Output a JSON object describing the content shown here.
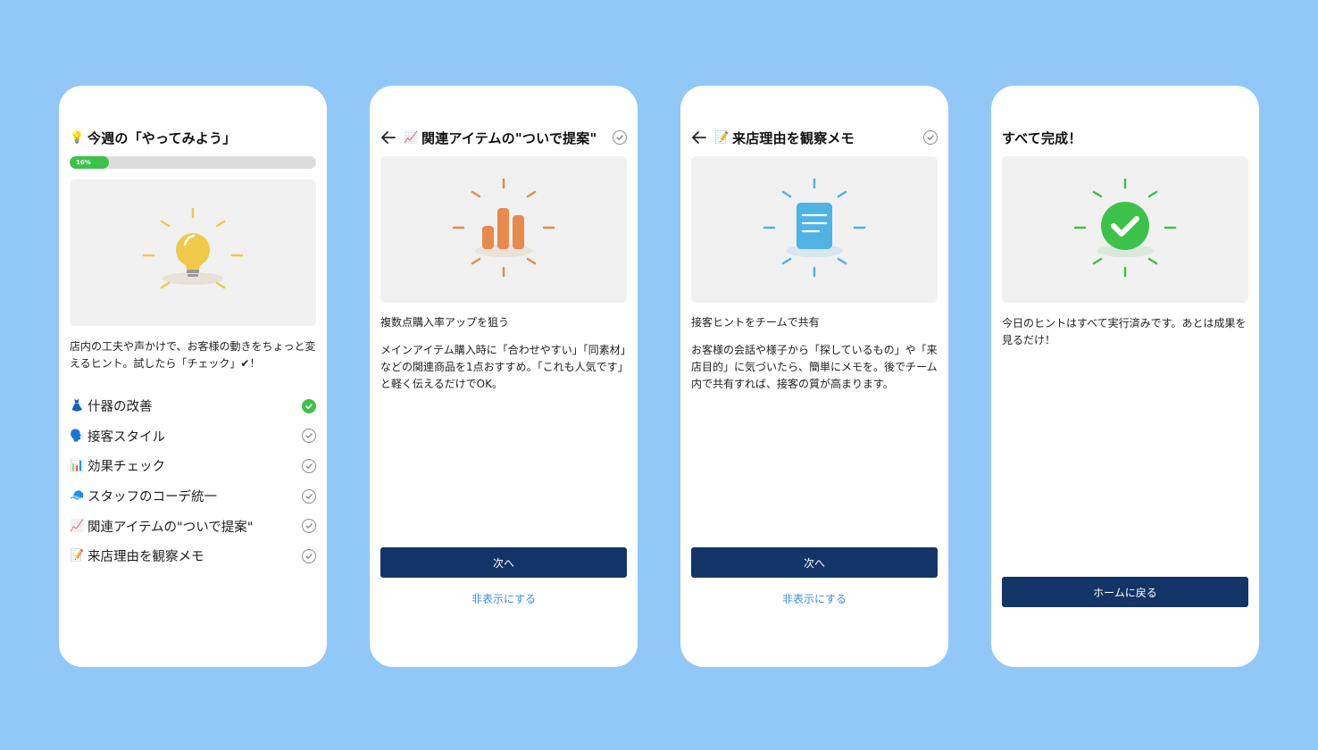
{
  "screens": [
    {
      "title": "今週の「やってみよう」",
      "title_emoji": "💡",
      "progress_label": "16%",
      "progress_fraction": 0.16,
      "description": "店内の工夫や声かけで、お客様の動きをちょっと変えるヒント。試したら「チェック」✔！",
      "items": [
        {
          "emoji": "👗",
          "label": "什器の改善",
          "done": true
        },
        {
          "emoji": "🗣️",
          "label": "接客スタイル",
          "done": false
        },
        {
          "emoji": "📊",
          "label": "効果チェック",
          "done": false
        },
        {
          "emoji": "🧢",
          "label": "スタッフのコーデ統一",
          "done": false
        },
        {
          "emoji": "📈",
          "label": "関連アイテムの\"ついで提案\"",
          "done": false
        },
        {
          "emoji": "📝",
          "label": "来店理由を観察メモ",
          "done": false
        }
      ]
    },
    {
      "title": "関連アイテムの\"ついで提案\"",
      "title_emoji": "📈",
      "subhead": "複数点購入率アップを狙う",
      "body": "メインアイテム購入時に「合わせやすい」「同素材」などの関連商品を1点おすすめ。「これも人気です」と軽く伝えるだけでOK。",
      "next_label": "次へ",
      "hide_label": "非表示にする"
    },
    {
      "title": "来店理由を観察メモ",
      "title_emoji": "📝",
      "subhead": "接客ヒントをチームで共有",
      "body": "お客様の会話や様子から「探しているもの」や「来店目的」に気づいたら、簡単にメモを。後でチーム内で共有すれば、接客の質が高まります。",
      "next_label": "次へ",
      "hide_label": "非表示にする"
    },
    {
      "title": "すべて完成！",
      "body": "今日のヒントはすべて実行済みです。あとは成果を見るだけ！",
      "home_label": "ホームに戻る"
    }
  ],
  "colors": {
    "background": "#92c8f8",
    "primary_button": "#133467",
    "link": "#3c8ee0",
    "done_green": "#3cc24a",
    "bulb_yellow": "#f0c94a",
    "chart_orange": "#e88a4c",
    "memo_blue": "#4fb3e3"
  },
  "icons": {
    "back": "arrow-left-icon",
    "check": "check-circle-icon",
    "bulb": "lightbulb-icon",
    "chart": "bar-chart-icon",
    "memo": "memo-document-icon",
    "complete": "check-badge-icon"
  }
}
